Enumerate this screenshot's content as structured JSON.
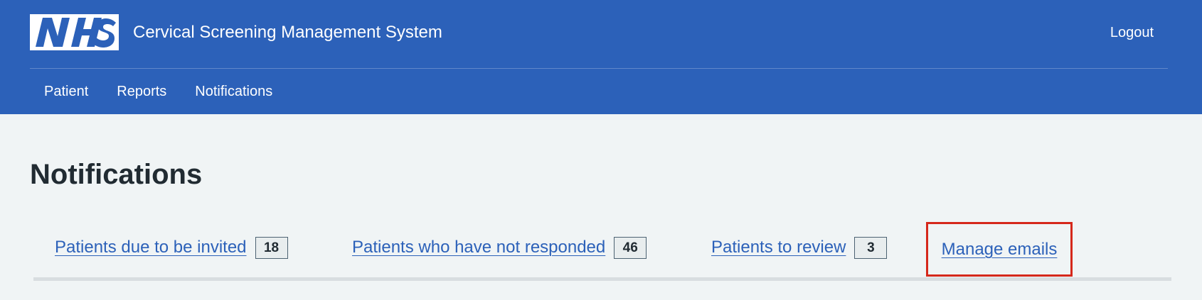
{
  "header": {
    "logo_text": "NHS",
    "service_name": "Cervical Screening Management System",
    "logout_label": "Logout",
    "background_color": "#2c61b9"
  },
  "nav": {
    "items": [
      {
        "label": "Patient"
      },
      {
        "label": "Reports"
      },
      {
        "label": "Notifications"
      }
    ]
  },
  "page": {
    "title": "Notifications"
  },
  "tabs": {
    "items": [
      {
        "label": "Patients due to be invited",
        "count": "18"
      },
      {
        "label": "Patients who have not responded",
        "count": "46"
      },
      {
        "label": "Patients to review",
        "count": "3"
      },
      {
        "label": "Manage emails",
        "highlighted": true,
        "highlight_color": "#d5281b"
      }
    ]
  },
  "colors": {
    "link": "#2c61b9",
    "page_background": "#f0f4f5",
    "text": "#212b32"
  }
}
